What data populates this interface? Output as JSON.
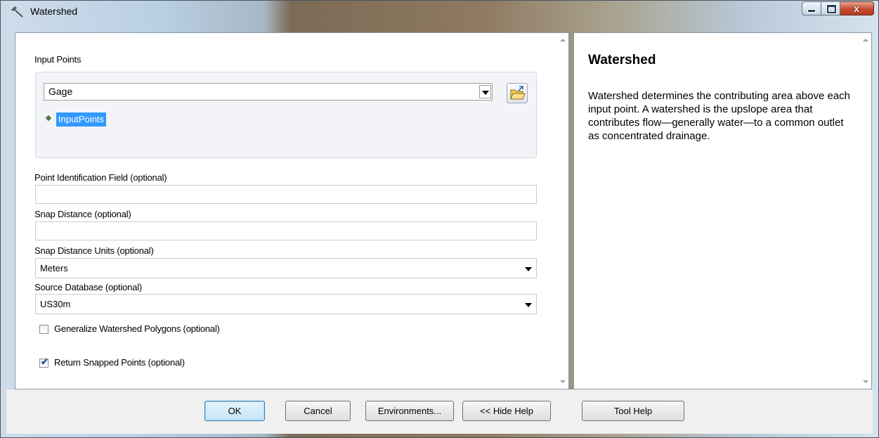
{
  "window": {
    "title": "Watershed",
    "controls": {
      "minimize": "minimize",
      "maximize": "maximize",
      "close": "x"
    }
  },
  "form": {
    "input_points": {
      "label": "Input Points",
      "value": "Gage",
      "list_items": [
        "InputPoints"
      ]
    },
    "point_id_field": {
      "label": "Point Identification Field (optional)",
      "value": ""
    },
    "snap_distance": {
      "label": "Snap Distance (optional)",
      "value": ""
    },
    "snap_distance_units": {
      "label": "Snap Distance Units (optional)",
      "value": "Meters"
    },
    "source_database": {
      "label": "Source Database (optional)",
      "value": "US30m"
    },
    "generalize": {
      "label": "Generalize Watershed Polygons (optional)",
      "checked": false
    },
    "return_snapped": {
      "label": "Return Snapped Points (optional)",
      "checked": true
    }
  },
  "help": {
    "title": "Watershed",
    "body": "Watershed determines the contributing area above each input point. A watershed is the upslope area that contributes flow—generally water—to a common outlet as concentrated drainage."
  },
  "buttons": {
    "ok": "OK",
    "cancel": "Cancel",
    "environments": "Environments...",
    "hide_help": "<< Hide Help",
    "tool_help": "Tool Help"
  },
  "icons": {
    "title": "hammer-icon",
    "folder": "open-folder-icon",
    "list_item": "point-feature-icon",
    "checkmark": "✔"
  },
  "colors": {
    "selection": "#3399ff",
    "default_button": "#c4e5f6",
    "close_button": "#c8492c"
  }
}
